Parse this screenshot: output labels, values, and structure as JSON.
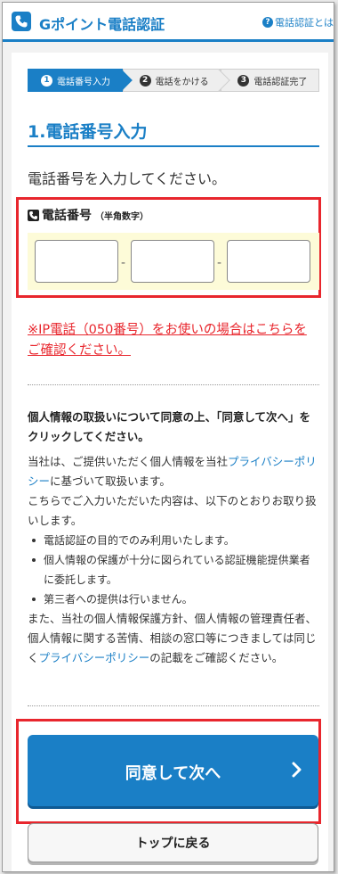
{
  "header": {
    "title": "Gポイント電話認証",
    "help_link": "電話認証とは",
    "help_icon": "question-circle-icon",
    "accent_color": "#1a7fc6"
  },
  "steps": [
    {
      "number": "1",
      "label": "電話番号入力",
      "active": true
    },
    {
      "number": "2",
      "label": "電話をかける",
      "active": false
    },
    {
      "number": "3",
      "label": "電話認証完了",
      "active": false
    }
  ],
  "section": {
    "title": "1.電話番号入力",
    "instruction": "電話番号を入力してください。"
  },
  "phone": {
    "label": "電話番号",
    "label_note": "（半角数字）",
    "icon": "phone-icon",
    "field1": "",
    "field2": "",
    "field3": "",
    "separator": "-"
  },
  "ip_note": "※IP電話（050番号）をお使いの場合はこちらをご確認ください。",
  "consent": {
    "title": "個人情報の取扱いについて同意の上、「同意して次へ」をクリックしてください。",
    "p1_before": "当社は、ご提供いただく個人情報を当社",
    "p1_link": "プライバシーポリシー",
    "p1_after": "に基づいて取扱います。",
    "p2": "こちらでご入力いただいた内容は、以下のとおりお取り扱いします。",
    "bullets": [
      "電話認証の目的でのみ利用いたします。",
      "個人情報の保護が十分に図られている認証機能提供業者に委託します。",
      "第三者への提供は行いません。"
    ],
    "p3_before": "また、当社の個人情報保護方針、個人情報の管理責任者、個人情報に関する苦情、相談の窓口等につきましては同じく",
    "p3_link": "プライバシーポリシー",
    "p3_after": "の記載をご確認ください。"
  },
  "buttons": {
    "next": "同意して次へ",
    "top": "トップに戻る"
  }
}
